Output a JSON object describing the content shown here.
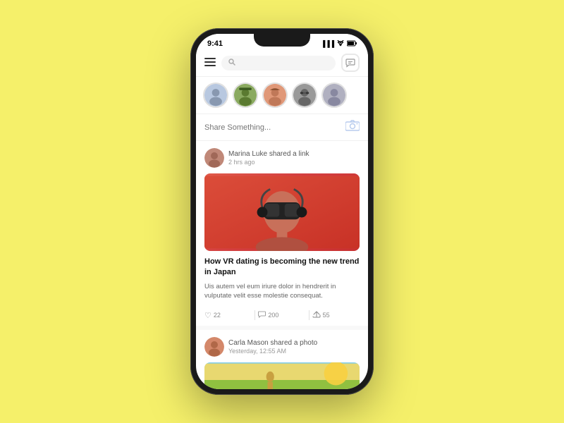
{
  "background_color": "#f5f06a",
  "phone": {
    "status_bar": {
      "time": "9:41",
      "signal": "▐▐▐",
      "wifi": "WiFi",
      "battery": "▐"
    },
    "header": {
      "search_placeholder": "Search",
      "chat_icon": "💬"
    },
    "stories": [
      {
        "id": 1,
        "color": "#b0c4de",
        "emoji": "🧑"
      },
      {
        "id": 2,
        "color": "#8aaa60",
        "emoji": "🌿"
      },
      {
        "id": 3,
        "color": "#d4886a",
        "emoji": "👩"
      },
      {
        "id": 4,
        "color": "#777",
        "emoji": "🕶"
      },
      {
        "id": 5,
        "color": "#a0a0b0",
        "emoji": "👤"
      }
    ],
    "share_box": {
      "placeholder": "Share Something...",
      "camera_label": "📷"
    },
    "posts": [
      {
        "id": 1,
        "author": "Marina Luke",
        "action": "shared a link",
        "time": "2 hrs ago",
        "avatar_color": "#c08878",
        "image_alt": "VR headset person",
        "title": "How VR dating is becoming the new trend in Japan",
        "body": "Uis autem vel eum iriure dolor in hendrerit in vulputate velit esse molestie consequat.",
        "likes": 22,
        "comments": 200,
        "shares": 55
      },
      {
        "id": 2,
        "author": "Carla Mason",
        "action": "shared a photo",
        "time": "Yesterday, 12:55 AM",
        "avatar_color": "#d4886a"
      }
    ],
    "actions": {
      "like_icon": "♡",
      "comment_icon": "💬",
      "share_icon": "↗"
    }
  }
}
